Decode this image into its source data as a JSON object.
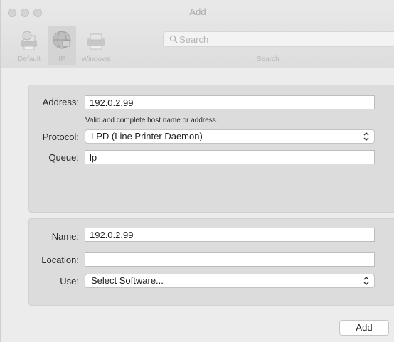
{
  "window": {
    "title": "Add"
  },
  "toolbar": {
    "items": [
      {
        "label": "Default",
        "icon": "default-printer-icon"
      },
      {
        "label": "IP",
        "icon": "ip-globe-icon",
        "selected": true
      },
      {
        "label": "Windows",
        "icon": "windows-printer-icon"
      }
    ],
    "search": {
      "placeholder": "Search",
      "value": "",
      "label": "Search"
    }
  },
  "printer": {
    "address": {
      "label": "Address:",
      "value": "192.0.2.99",
      "hint": "Valid and complete host name or address."
    },
    "protocol": {
      "label": "Protocol:",
      "value": "LPD (Line Printer Daemon)"
    },
    "queue": {
      "label": "Queue:",
      "value": "lp"
    }
  },
  "details": {
    "name": {
      "label": "Name:",
      "value": "192.0.2.99"
    },
    "location": {
      "label": "Location:",
      "value": ""
    },
    "use": {
      "label": "Use:",
      "value": "Select Software..."
    }
  },
  "actions": {
    "add_label": "Add"
  },
  "colors": {
    "window_bg": "#ececec",
    "panel_bg": "#dcdcdc",
    "field_bg": "#ffffff"
  }
}
